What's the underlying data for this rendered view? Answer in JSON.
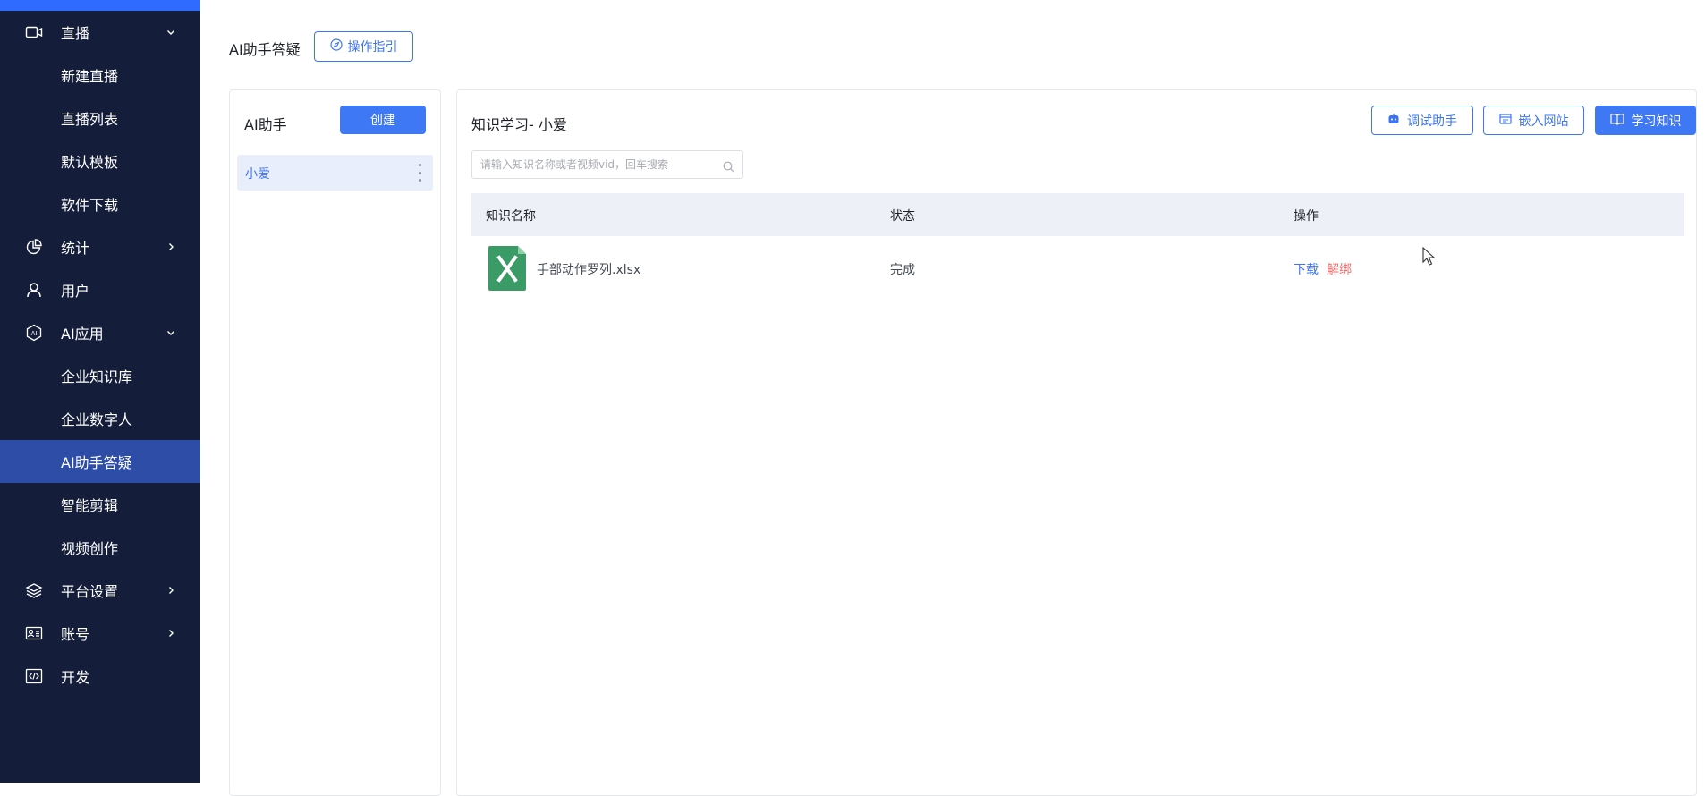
{
  "colors": {
    "sidebar_bg": "#141e3a",
    "sidebar_active": "#2e4da6",
    "accent": "#3f78f5",
    "danger": "#f56c6c",
    "excel_green": "#3a9b66"
  },
  "sidebar": {
    "items": [
      {
        "label": "直播",
        "icon": "video-camera-icon",
        "chevron": "down"
      },
      {
        "label": "新建直播"
      },
      {
        "label": "直播列表"
      },
      {
        "label": "默认模板"
      },
      {
        "label": "软件下载"
      },
      {
        "label": "统计",
        "icon": "pie-chart-icon",
        "chevron": "right"
      },
      {
        "label": "用户",
        "icon": "user-icon"
      },
      {
        "label": "AI应用",
        "icon": "ai-hexagon-icon",
        "chevron": "down"
      },
      {
        "label": "企业知识库"
      },
      {
        "label": "企业数字人"
      },
      {
        "label": "AI助手答疑",
        "active": true
      },
      {
        "label": "智能剪辑"
      },
      {
        "label": "视频创作"
      },
      {
        "label": "平台设置",
        "icon": "layers-icon",
        "chevron": "right"
      },
      {
        "label": "账号",
        "icon": "id-card-icon",
        "chevron": "right"
      },
      {
        "label": "开发",
        "icon": "code-icon"
      }
    ]
  },
  "header": {
    "title": "AI助手答疑",
    "guide_button": "操作指引"
  },
  "assistants": {
    "title": "AI助手",
    "create_button": "创建",
    "items": [
      {
        "name": "小爱"
      }
    ]
  },
  "knowledge": {
    "title": "知识学习- 小爱",
    "buttons": {
      "debug": "调试助手",
      "embed": "嵌入网站",
      "learn": "学习知识"
    },
    "search": {
      "placeholder": "请输入知识名称或者视频vid，回车搜索",
      "value": ""
    },
    "columns": [
      "知识名称",
      "状态",
      "操作"
    ],
    "rows": [
      {
        "name": "手部动作罗列.xlsx",
        "file_icon": "excel-file-icon",
        "status": "完成",
        "actions": [
          "下载",
          "解绑"
        ]
      }
    ]
  }
}
